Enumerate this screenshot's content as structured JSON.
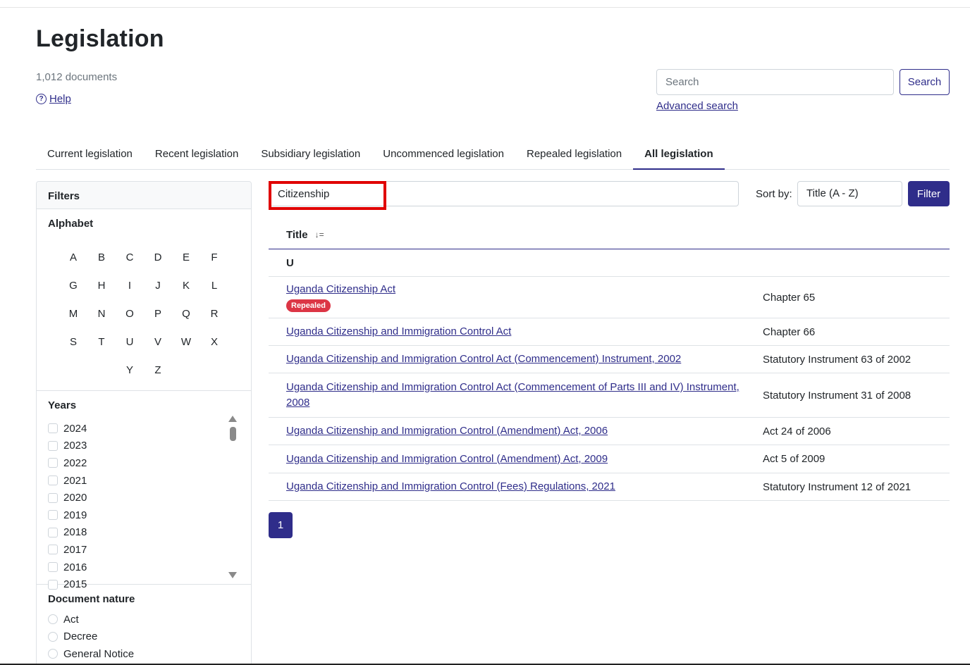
{
  "page": {
    "title": "Legislation",
    "doc_count": "1,012 documents",
    "help_label": "Help"
  },
  "search": {
    "placeholder": "Search",
    "button_label": "Search",
    "advanced_label": "Advanced search"
  },
  "tabs": [
    {
      "label": "Current legislation",
      "active": false
    },
    {
      "label": "Recent legislation",
      "active": false
    },
    {
      "label": "Subsidiary legislation",
      "active": false
    },
    {
      "label": "Uncommenced legislation",
      "active": false
    },
    {
      "label": "Repealed legislation",
      "active": false
    },
    {
      "label": "All legislation",
      "active": true
    }
  ],
  "filters": {
    "header": "Filters",
    "alphabet_title": "Alphabet",
    "letters": [
      "A",
      "B",
      "C",
      "D",
      "E",
      "F",
      "G",
      "H",
      "I",
      "J",
      "K",
      "L",
      "M",
      "N",
      "O",
      "P",
      "Q",
      "R",
      "S",
      "T",
      "U",
      "V",
      "W",
      "X",
      "Y",
      "Z"
    ],
    "years_title": "Years",
    "years": [
      "2024",
      "2023",
      "2022",
      "2021",
      "2020",
      "2019",
      "2018",
      "2017",
      "2016",
      "2015"
    ],
    "nature_title": "Document nature",
    "natures": [
      "Act",
      "Decree",
      "General Notice"
    ]
  },
  "list_filter": {
    "value": "Citizenship",
    "sort_label": "Sort by:",
    "sort_value": "Title (A - Z)",
    "filter_button": "Filter"
  },
  "table": {
    "title_header": "Title",
    "group_letter": "U",
    "rows": [
      {
        "title": "Uganda Citizenship Act",
        "citation": "Chapter 65",
        "badge": "Repealed"
      },
      {
        "title": "Uganda Citizenship and Immigration Control Act",
        "citation": "Chapter 66",
        "badge": ""
      },
      {
        "title": "Uganda Citizenship and Immigration Control Act (Commencement) Instrument, 2002",
        "citation": "Statutory Instrument 63 of 2002",
        "badge": ""
      },
      {
        "title": "Uganda Citizenship and Immigration Control Act (Commencement of Parts III and IV) Instrument, 2008",
        "citation": "Statutory Instrument 31 of 2008",
        "badge": ""
      },
      {
        "title": "Uganda Citizenship and Immigration Control (Amendment) Act, 2006",
        "citation": "Act 24 of 2006",
        "badge": ""
      },
      {
        "title": "Uganda Citizenship and Immigration Control (Amendment) Act, 2009",
        "citation": "Act 5 of 2009",
        "badge": ""
      },
      {
        "title": "Uganda Citizenship and Immigration Control (Fees) Regulations, 2021",
        "citation": "Statutory Instrument 12 of 2021",
        "badge": ""
      }
    ]
  },
  "pagination": {
    "current_page": "1"
  },
  "colors": {
    "primary": "#2f2d8a",
    "badge_red": "#dc3545",
    "highlight_red": "#e00000"
  }
}
